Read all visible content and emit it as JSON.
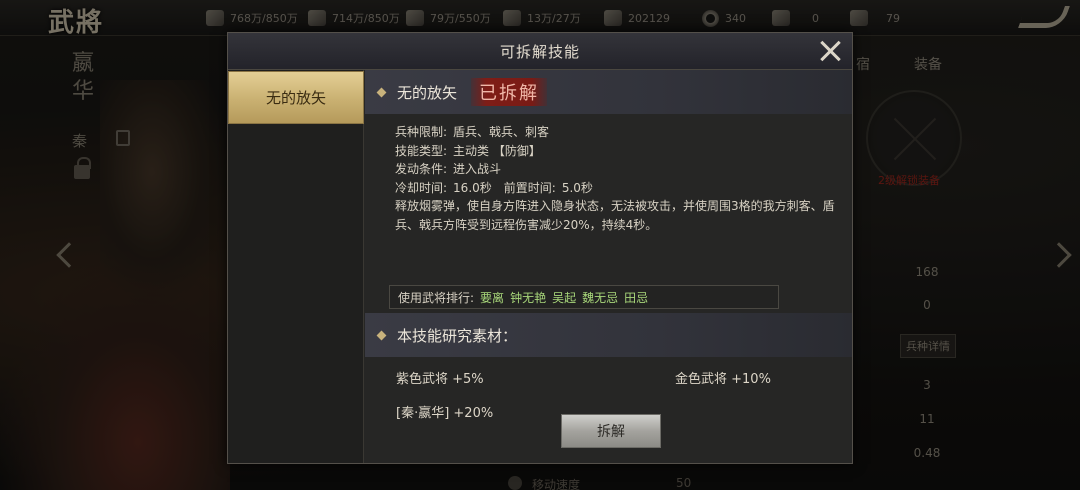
{
  "app": {
    "logo": "武將"
  },
  "resources": [
    {
      "icon": "food-icon",
      "text": "768万/850万"
    },
    {
      "icon": "wood-icon",
      "text": "714万/850万"
    },
    {
      "icon": "stone-icon",
      "text": "79万/550万"
    },
    {
      "icon": "iron-icon",
      "text": "13万/27万"
    },
    {
      "icon": "flag-icon",
      "text": "202129"
    },
    {
      "icon": "coin-icon",
      "text": "340"
    },
    {
      "icon": "silver-icon",
      "text": "0"
    },
    {
      "icon": "gold-icon",
      "text": "79"
    }
  ],
  "background": {
    "hero_name": "嬴华",
    "hero_faction": "秦",
    "tab_partial": "宿",
    "tab_equipment": "装备",
    "equip_caption": "2级解锁装备",
    "stats": [
      "168",
      "0",
      "3",
      "11",
      "0.48"
    ],
    "troop_detail_btn": "兵种详情",
    "bottom_stat_label": "移动速度",
    "bottom_stat_value": "50"
  },
  "modal": {
    "title": "可拆解技能",
    "close_label": "关闭"
  },
  "skill_list": [
    {
      "name": "无的放矢",
      "selected": true
    }
  ],
  "skill": {
    "name": "无的放矢",
    "status": "已拆解",
    "attrs": {
      "troop_limit_key": "兵种限制:",
      "troop_limit_val": "盾兵、戟兵、刺客",
      "skill_type_key": "技能类型:",
      "skill_type_val": "主动类 【防御】",
      "trigger_key": "发动条件:",
      "trigger_val": "进入战斗",
      "cooldown_key": "冷却时间:",
      "cooldown_val": "16.0秒",
      "precast_key": "前置时间:",
      "precast_val": "5.0秒"
    },
    "description": "释放烟雾弹，使自身方阵进入隐身状态，无法被攻击，并使周围3格的我方刺客、盾兵、戟兵方阵受到远程伤害减少20%，持续4秒。",
    "users_label": "使用武将排行:",
    "users": [
      "要离",
      "钟无艳",
      "吴起",
      "魏无忌",
      "田忌"
    ]
  },
  "materials": {
    "section_title": "本技能研究素材：",
    "purple": "紫色武将 +5%",
    "gold": "金色武将 +10%",
    "specific": "[秦·嬴华] +20%"
  },
  "actions": {
    "disassemble": "拆解"
  }
}
